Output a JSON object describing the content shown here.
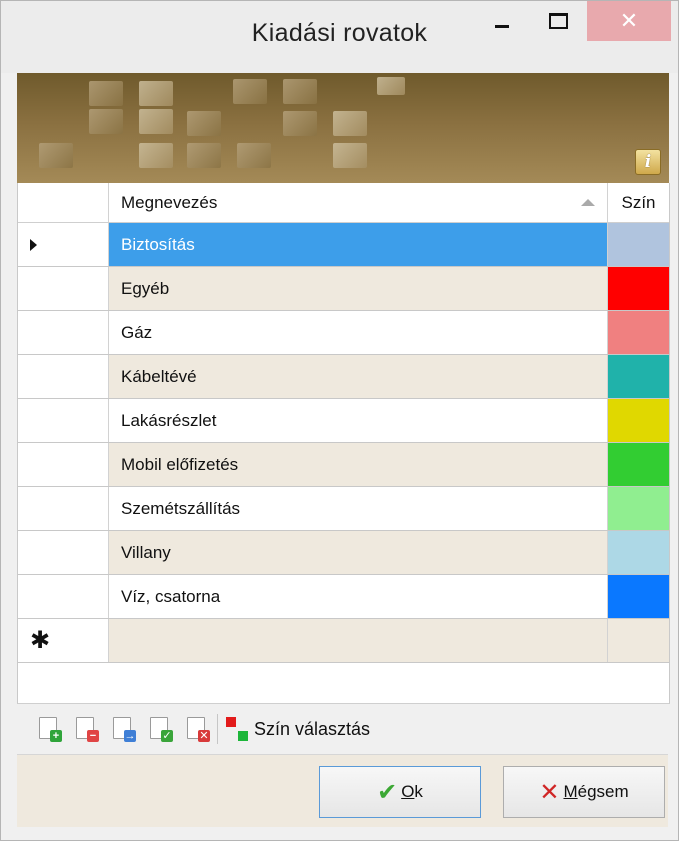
{
  "window": {
    "title": "Kiadási rovatok",
    "minimize_icon": "minimize-icon",
    "maximize_icon": "maximize-icon",
    "close_icon": "close-icon",
    "close_glyph": "✕"
  },
  "banner": {
    "info_glyph": "i"
  },
  "grid": {
    "columns": {
      "name": "Megnevezés",
      "color": "Szín"
    },
    "rows": [
      {
        "name": "Biztosítás",
        "color": "#b0c4de"
      },
      {
        "name": "Egyéb",
        "color": "#ff0000"
      },
      {
        "name": "Gáz",
        "color": "#f08080"
      },
      {
        "name": "Kábeltévé",
        "color": "#20b2aa"
      },
      {
        "name": "Lakásrészlet",
        "color": "#e0d800"
      },
      {
        "name": "Mobil előfizetés",
        "color": "#32cd32"
      },
      {
        "name": "Szemétszállítás",
        "color": "#90ee90"
      },
      {
        "name": "Villany",
        "color": "#add8e6"
      },
      {
        "name": "Víz, csatorna",
        "color": "#0a78ff"
      }
    ],
    "new_row_marker": "✱"
  },
  "toolbar": {
    "color_pick_label": "Szín választás"
  },
  "footer": {
    "ok_label_prefix": "O",
    "ok_label_rest": "k",
    "cancel_label_prefix": "M",
    "cancel_label_rest": "égsem"
  }
}
